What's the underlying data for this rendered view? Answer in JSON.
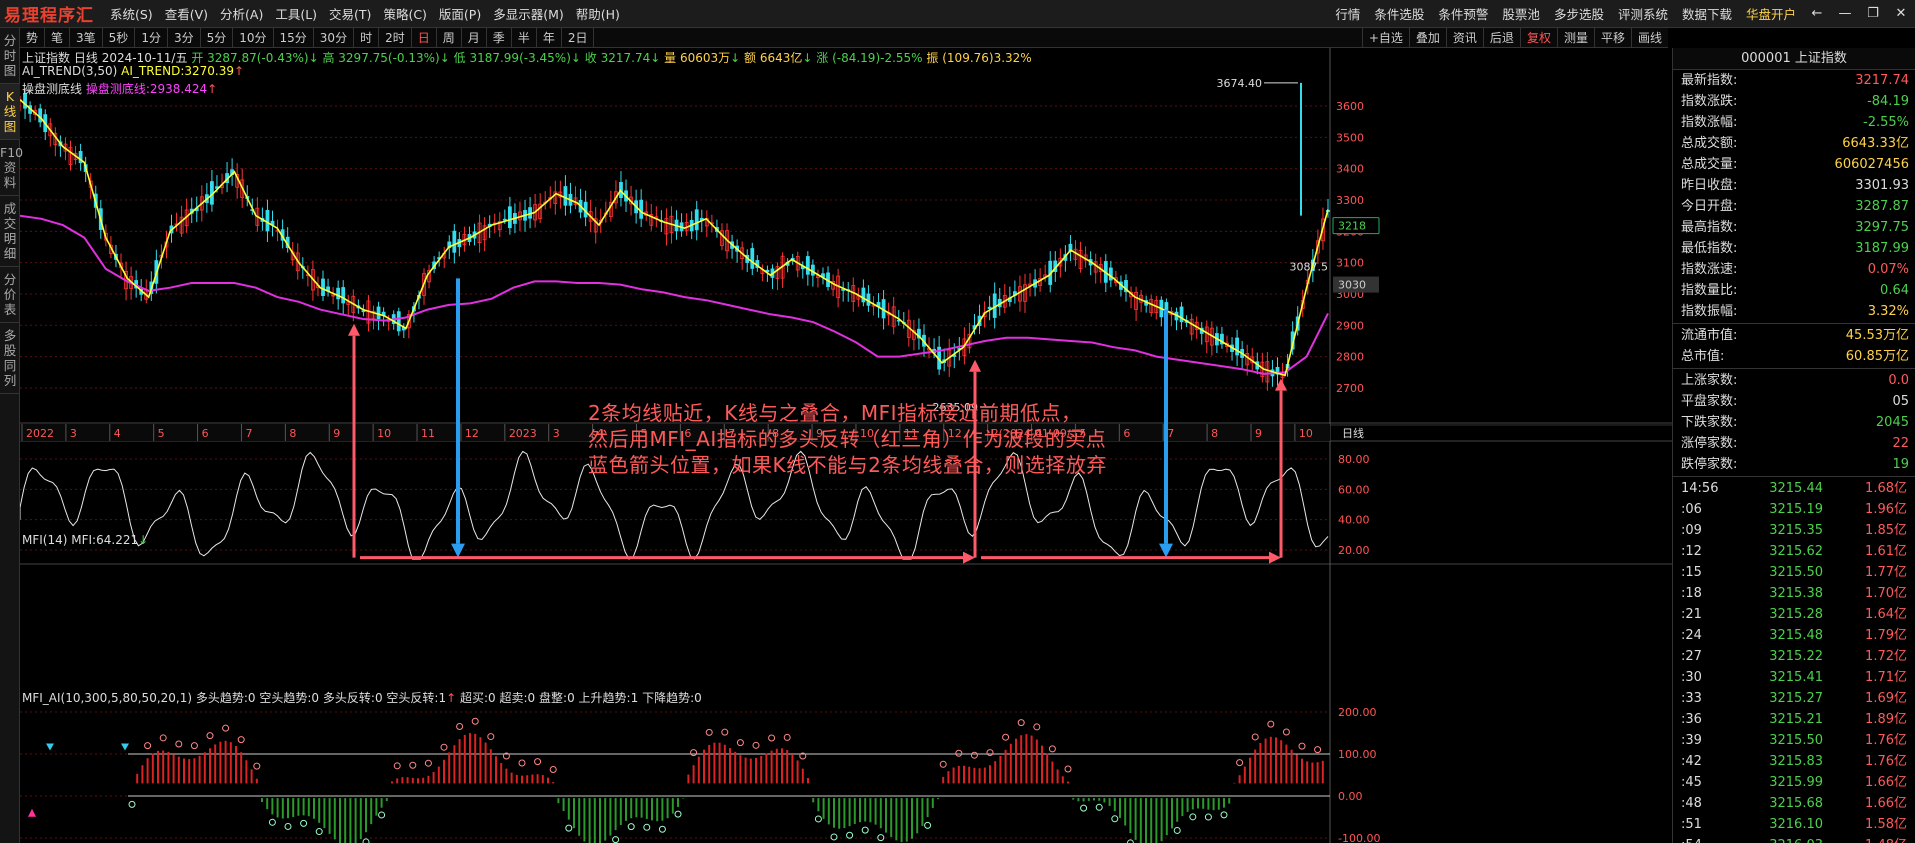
{
  "menubar": {
    "logo": "易理程序汇",
    "items": [
      "系统(S)",
      "查看(V)",
      "分析(A)",
      "工具(L)",
      "交易(T)",
      "策略(C)",
      "版面(P)",
      "多显示器(M)",
      "帮助(H)"
    ],
    "right_items": [
      "行情",
      "条件选股",
      "条件预警",
      "股票池",
      "多步选股",
      "评测系统",
      "数据下载"
    ],
    "open_account": "华盘开户"
  },
  "left_tabs": [
    "分时图",
    "K线图",
    "F10资料",
    "成交明细",
    "分价表",
    "多股同列"
  ],
  "toolbar": {
    "periods": [
      "势",
      "笔",
      "3笔",
      "5秒",
      "1分",
      "3分",
      "5分",
      "10分",
      "15分",
      "30分",
      "时",
      "2时",
      "日",
      "周",
      "月",
      "季",
      "半",
      "年",
      "2日"
    ],
    "active": "日",
    "tools": [
      "+自选",
      "叠加",
      "资讯",
      "后退",
      "复权",
      "测量",
      "平移",
      "画线"
    ]
  },
  "info": {
    "name": "上证指数",
    "period": "日线",
    "date": "2024-10-11/五",
    "open": "开 3287.87(-0.43%)",
    "high": "高 3297.75(-0.13%)",
    "low": "低 3187.99(-3.45%)",
    "close": "收 3217.74",
    "volume": "量 60603万",
    "amount": "额 6643亿",
    "change": "涨 (-84.19)-2.55%",
    "swing": "振 (109.76)3.32%"
  },
  "ai_trend": {
    "name": "AI_TREND(3,50)",
    "value": "AI_TREND:3270.39"
  },
  "bottom_line": {
    "name": "操盘测底线",
    "value": "操盘测底线:2938.424"
  },
  "annotation": {
    "line1": "2条均线贴近，K线与之叠合，MFI指标接近前期低点，",
    "line2": "然后用MFI_AI指标的多头反转（红三角）作为波段的买点",
    "line3": "蓝色箭头位置，如果K线不能与2条均线叠合，则选择放弃"
  },
  "price_axis": {
    "labels": [
      "3600",
      "3500",
      "3400",
      "3300",
      "3200",
      "3100",
      "3000",
      "2900",
      "2800",
      "2700"
    ],
    "current": "3218",
    "level": "3030",
    "hi_label": "3674.40",
    "lo_label": "2635.09",
    "mark_label": "3087.5"
  },
  "x_axis": {
    "labels": [
      "2022",
      "3",
      "4",
      "5",
      "6",
      "7",
      "8",
      "9",
      "10",
      "11",
      "12",
      "2023",
      "3",
      "4",
      "5",
      "6",
      "7",
      "8",
      "9",
      "10",
      "11",
      "12",
      "2(2024-01-09/二)",
      "4",
      "5",
      "6",
      "7",
      "8",
      "9",
      "10"
    ],
    "period": "日线"
  },
  "mfi": {
    "head_name": "MFI(14)",
    "head_value": "MFI:64.221",
    "axis": [
      "80.00",
      "60.00",
      "40.00",
      "20.00"
    ]
  },
  "mfi_ai": {
    "head_name": "MFI_AI(10,300,5,80,50,20,1)",
    "fields": [
      "多头趋势:0",
      "空头趋势:0",
      "多头反转:0",
      "空头反转:1",
      "超买:0",
      "超卖:0",
      "盘整:0",
      "上升趋势:1",
      "下降趋势:0"
    ],
    "axis": [
      "200.00",
      "100.00",
      "0.00",
      "-100.00"
    ]
  },
  "quote_panel": {
    "title": "000001 上证指数",
    "rows": [
      {
        "label": "最新指数:",
        "value": "3217.74",
        "color": "#ff5a5a"
      },
      {
        "label": "指数涨跌:",
        "value": "-84.19",
        "color": "#4dd04d"
      },
      {
        "label": "指数涨幅:",
        "value": "-2.55%",
        "color": "#4dd04d"
      },
      {
        "label": "总成交额:",
        "value": "6643.33亿",
        "color": "#ffd24a"
      },
      {
        "label": "总成交量:",
        "value": "606027456",
        "color": "#ffd24a"
      },
      {
        "label": "昨日收盘:",
        "value": "3301.93",
        "color": "#dddddd"
      },
      {
        "label": "今日开盘:",
        "value": "3287.87",
        "color": "#4dd04d"
      },
      {
        "label": "最高指数:",
        "value": "3297.75",
        "color": "#4dd04d"
      },
      {
        "label": "最低指数:",
        "value": "3187.99",
        "color": "#4dd04d"
      },
      {
        "label": "指数涨速:",
        "value": "0.07%",
        "color": "#ff5a5a"
      },
      {
        "label": "指数量比:",
        "value": "0.64",
        "color": "#4dd04d"
      },
      {
        "label": "指数振幅:",
        "value": "3.32%",
        "color": "#ffd24a"
      }
    ],
    "rows2": [
      {
        "label": "流通市值:",
        "value": "45.53万亿",
        "color": "#ffd24a"
      },
      {
        "label": "总市值:",
        "value": "60.85万亿",
        "color": "#ffd24a"
      }
    ],
    "rows3": [
      {
        "label": "上涨家数:",
        "value": "0.0",
        "color": "#ff5a5a"
      },
      {
        "label": "平盘家数:",
        "value": "05",
        "color": "#dddddd"
      },
      {
        "label": "下跌家数:",
        "value": "2045",
        "color": "#4dd04d"
      },
      {
        "label": "涨停家数:",
        "value": "22",
        "color": "#ff5a5a"
      },
      {
        "label": "跌停家数:",
        "value": "19",
        "color": "#4dd04d"
      }
    ]
  },
  "ticks": [
    {
      "t": "14:56",
      "p": "3215.44",
      "v": "1.68亿"
    },
    {
      "t": ":06",
      "p": "3215.19",
      "v": "1.96亿"
    },
    {
      "t": ":09",
      "p": "3215.35",
      "v": "1.85亿"
    },
    {
      "t": ":12",
      "p": "3215.62",
      "v": "1.61亿"
    },
    {
      "t": ":15",
      "p": "3215.50",
      "v": "1.77亿"
    },
    {
      "t": ":18",
      "p": "3215.38",
      "v": "1.70亿"
    },
    {
      "t": ":21",
      "p": "3215.28",
      "v": "1.64亿"
    },
    {
      "t": ":24",
      "p": "3215.48",
      "v": "1.79亿"
    },
    {
      "t": ":27",
      "p": "3215.22",
      "v": "1.72亿"
    },
    {
      "t": ":30",
      "p": "3215.41",
      "v": "1.71亿"
    },
    {
      "t": ":33",
      "p": "3215.27",
      "v": "1.69亿"
    },
    {
      "t": ":36",
      "p": "3215.21",
      "v": "1.89亿"
    },
    {
      "t": ":39",
      "p": "3215.50",
      "v": "1.76亿"
    },
    {
      "t": ":42",
      "p": "3215.83",
      "v": "1.76亿"
    },
    {
      "t": ":45",
      "p": "3215.99",
      "v": "1.66亿"
    },
    {
      "t": ":48",
      "p": "3215.68",
      "v": "1.66亿"
    },
    {
      "t": ":51",
      "p": "3216.10",
      "v": "1.58亿"
    },
    {
      "t": ":54",
      "p": "3216.03",
      "v": "1.48亿"
    }
  ],
  "chart_data": {
    "type": "candlestick",
    "series": [
      {
        "name": "AI_TREND",
        "values": [
          3620,
          3560,
          3470,
          3420,
          3180,
          3050,
          2990,
          3200,
          3260,
          3320,
          3390,
          3250,
          3210,
          3100,
          3020,
          2990,
          2950,
          2930,
          2890,
          3060,
          3150,
          3180,
          3220,
          3240,
          3260,
          3320,
          3290,
          3220,
          3330,
          3260,
          3230,
          3210,
          3240,
          3170,
          3110,
          3060,
          3110,
          3070,
          3030,
          3000,
          2960,
          2920,
          2860,
          2780,
          2830,
          2940,
          2980,
          3020,
          3060,
          3140,
          3100,
          3050,
          2990,
          2960,
          2930,
          2890,
          2850,
          2810,
          2760,
          2740,
          3020,
          3270
        ]
      },
      {
        "name": "操盘测底线",
        "values": [
          3250,
          3240,
          3220,
          3180,
          3080,
          3040,
          3010,
          3020,
          3035,
          3035,
          3035,
          3020,
          2990,
          2975,
          2950,
          2935,
          2920,
          2915,
          2925,
          2950,
          2965,
          2970,
          2985,
          3020,
          3040,
          3040,
          3035,
          3035,
          3030,
          3015,
          3005,
          2990,
          2980,
          2965,
          2950,
          2935,
          2925,
          2910,
          2880,
          2845,
          2800,
          2800,
          2810,
          2820,
          2835,
          2850,
          2860,
          2860,
          2855,
          2850,
          2845,
          2830,
          2820,
          2800,
          2790,
          2780,
          2770,
          2760,
          2745,
          2750,
          2800,
          2938
        ]
      }
    ]
  }
}
